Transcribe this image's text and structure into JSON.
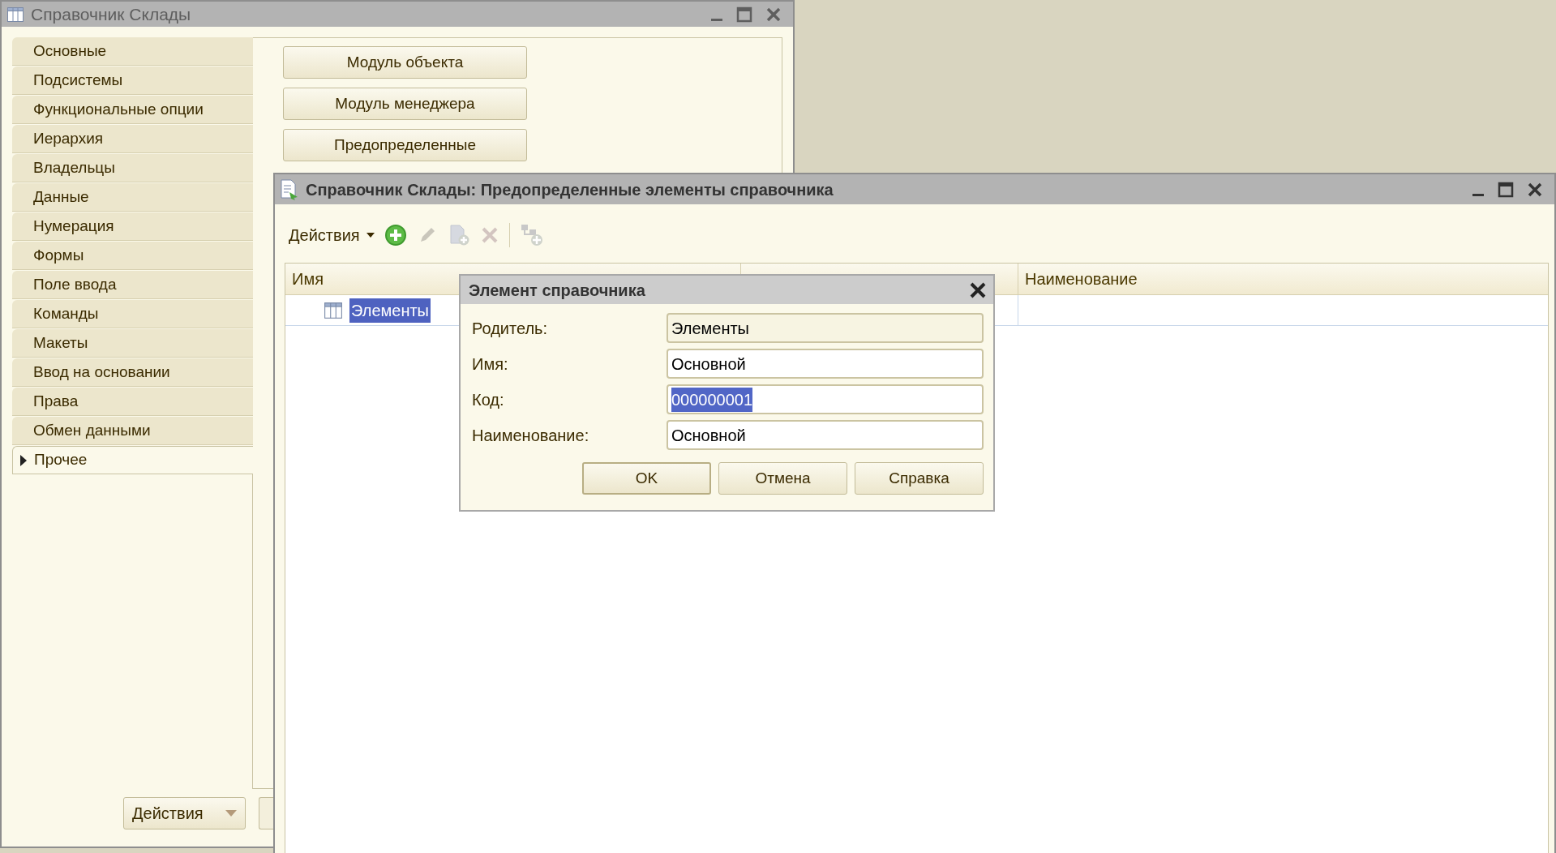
{
  "main_window": {
    "title": "Справочник Склады",
    "sections": [
      {
        "label": "Основные",
        "selected": false,
        "expandable": false
      },
      {
        "label": "Подсистемы",
        "selected": false,
        "expandable": false
      },
      {
        "label": "Функциональные опции",
        "selected": false,
        "expandable": false
      },
      {
        "label": "Иерархия",
        "selected": false,
        "expandable": false
      },
      {
        "label": "Владельцы",
        "selected": false,
        "expandable": false
      },
      {
        "label": "Данные",
        "selected": false,
        "expandable": false
      },
      {
        "label": "Нумерация",
        "selected": false,
        "expandable": false
      },
      {
        "label": "Формы",
        "selected": false,
        "expandable": false
      },
      {
        "label": "Поле ввода",
        "selected": false,
        "expandable": false
      },
      {
        "label": "Команды",
        "selected": false,
        "expandable": false
      },
      {
        "label": "Макеты",
        "selected": false,
        "expandable": false
      },
      {
        "label": "Ввод на основании",
        "selected": false,
        "expandable": false
      },
      {
        "label": "Права",
        "selected": false,
        "expandable": false
      },
      {
        "label": "Обмен данными",
        "selected": false,
        "expandable": false
      },
      {
        "label": "Прочее",
        "selected": true,
        "expandable": true
      }
    ],
    "buttons": [
      "Модуль объекта",
      "Модуль менеджера",
      "Предопределенные"
    ],
    "actions_button": "Действия"
  },
  "predefined_window": {
    "title": "Справочник Склады: Предопределенные элементы справочника",
    "actions_menu": "Действия",
    "tools": [
      {
        "kind": "add",
        "disabled": false
      },
      {
        "kind": "edit",
        "disabled": true
      },
      {
        "kind": "copy",
        "disabled": true
      },
      {
        "kind": "delete",
        "disabled": true
      },
      {
        "kind": "add-group",
        "disabled": true
      }
    ],
    "table": {
      "columns": [
        "Имя",
        "Наименование"
      ],
      "rows": [
        {
          "name": "Элементы",
          "selected": true
        }
      ]
    }
  },
  "dialog": {
    "title": "Элемент справочника",
    "fields": [
      {
        "label": "Родитель:",
        "value": "Элементы",
        "readonly": true,
        "text_selected": false
      },
      {
        "label": "Имя:",
        "value": "Основной",
        "readonly": false,
        "text_selected": false
      },
      {
        "label": "Код:",
        "value": "000000001",
        "readonly": false,
        "text_selected": true
      },
      {
        "label": "Наименование:",
        "value": "Основной",
        "readonly": false,
        "text_selected": false
      }
    ],
    "buttons": [
      {
        "label": "OK",
        "default": true
      },
      {
        "label": "Отмена",
        "default": false
      },
      {
        "label": "Справка",
        "default": false
      }
    ]
  }
}
